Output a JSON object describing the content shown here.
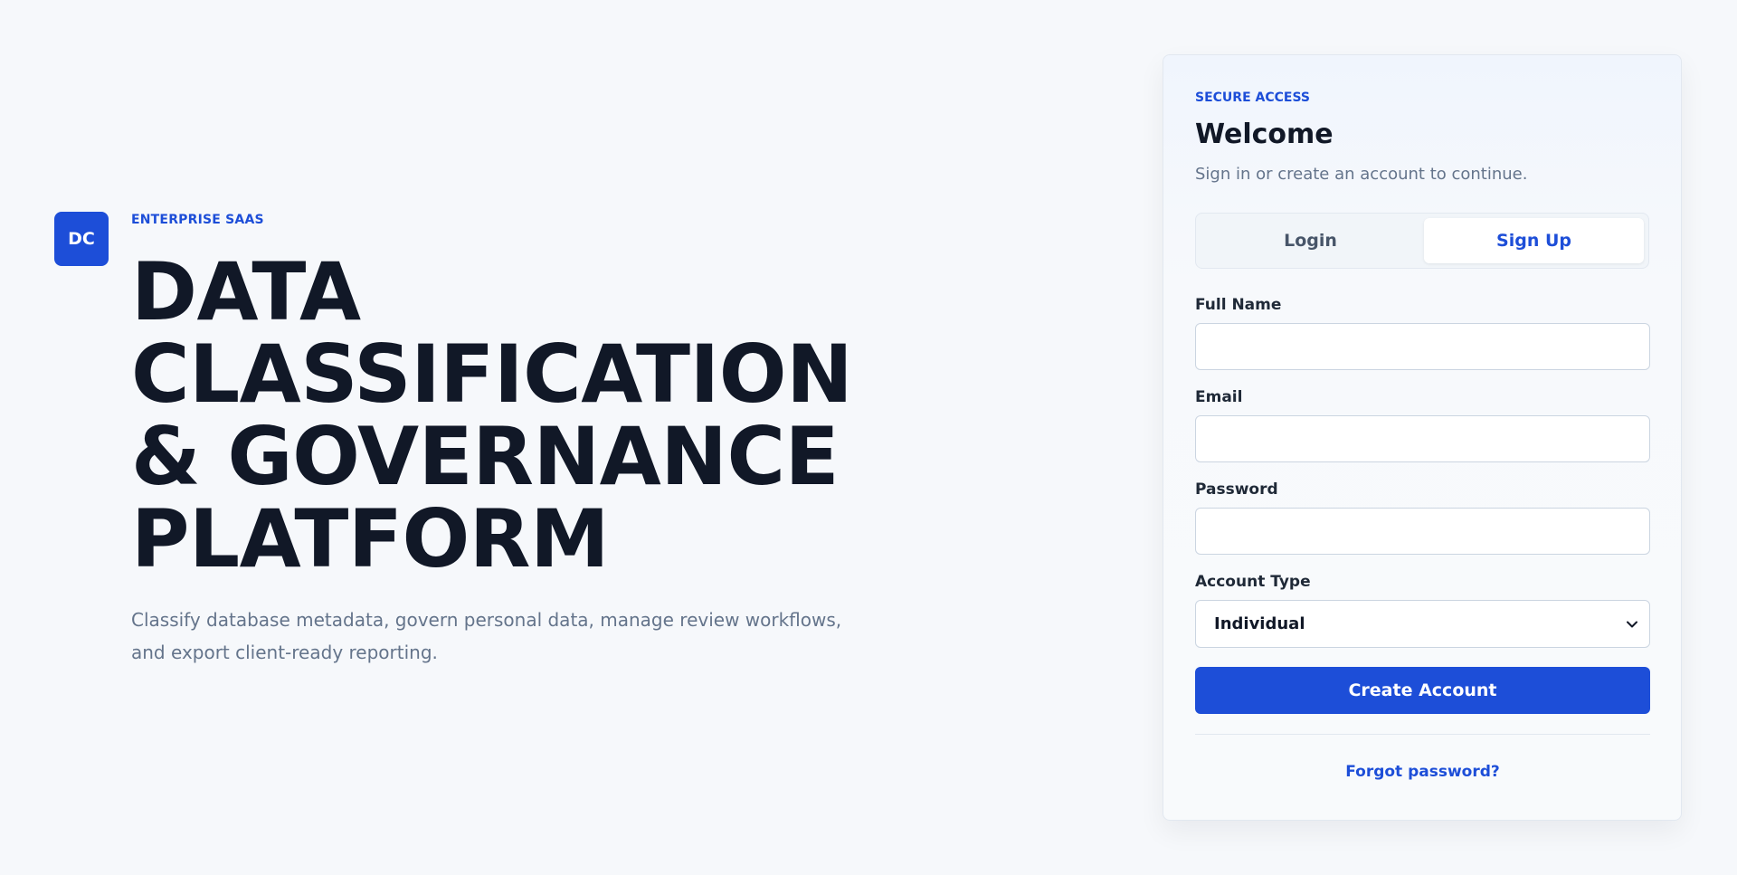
{
  "logo": {
    "text": "DC"
  },
  "hero": {
    "eyebrow": "ENTERPRISE SAAS",
    "title": "DATA CLASSIFICATION & GOVERNANCE PLATFORM",
    "subtitle": "Classify database metadata, govern personal data, manage review workflows, and export client-ready reporting."
  },
  "card": {
    "eyebrow": "SECURE ACCESS",
    "title": "Welcome",
    "subtitle": "Sign in or create an account to continue.",
    "tabs": [
      {
        "label": "Login",
        "active": false
      },
      {
        "label": "Sign Up",
        "active": true
      }
    ],
    "fields": {
      "full_name": {
        "label": "Full Name",
        "value": ""
      },
      "email": {
        "label": "Email",
        "value": ""
      },
      "password": {
        "label": "Password",
        "value": ""
      },
      "account_type": {
        "label": "Account Type",
        "value": "Individual"
      }
    },
    "submit_label": "Create Account",
    "forgot_label": "Forgot password?"
  },
  "colors": {
    "accent": "#1d4ed8",
    "background": "#f6f8fb",
    "heading": "#111827",
    "muted": "#64748b"
  }
}
